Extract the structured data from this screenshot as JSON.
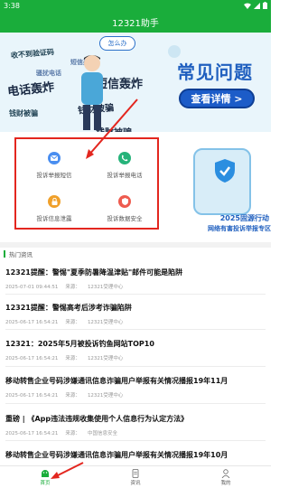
{
  "status_bar": {
    "time": "3:38"
  },
  "app_bar": {
    "title": "12321助手"
  },
  "banner": {
    "bubble": "怎么办",
    "keywords": [
      "收不到验证码",
      "电话轰炸",
      "骚扰电话",
      "钱财被骗",
      "短信轰炸",
      "短信轰炸",
      "钱财被骗",
      "钱财被骗"
    ],
    "headline": "常见问题",
    "detail_button": "查看详情 >"
  },
  "quick_actions": [
    {
      "label": "投诉举报短信",
      "icon": "mail-icon"
    },
    {
      "label": "投诉举报电话",
      "icon": "phone-icon"
    },
    {
      "label": "投诉信息泄露",
      "icon": "lock-icon"
    },
    {
      "label": "投诉数据安全",
      "icon": "shield-icon"
    }
  ],
  "promo": {
    "line1": "2025固源行动",
    "line2": "网络有害投诉举报专区"
  },
  "section": {
    "title": "热门资讯"
  },
  "news": [
    {
      "title": "12321提醒：警惕\"夏季防暑降温津贴\"邮件可能是陷阱",
      "date": "2025-07-01 09:44:51",
      "source_label": "来源：",
      "source": "12321受理中心"
    },
    {
      "title": "12321提醒：警惕高考后涉考诈骗陷阱",
      "date": "2025-06-17 16:54:21",
      "source_label": "来源：",
      "source": "12321受理中心"
    },
    {
      "title": "12321：2025年5月被投诉钓鱼网站TOP10",
      "date": "2025-06-17 16:54:21",
      "source_label": "来源：",
      "source": "12321受理中心"
    },
    {
      "title": "移动转售企业号码涉嫌通讯信息诈骗用户举报有关情况播报19年11月",
      "date": "2025-06-17 16:54:21",
      "source_label": "来源：",
      "source": "12321受理中心"
    },
    {
      "title": "重磅 | 《App违法违规收集使用个人信息行为认定方法》",
      "date": "2025-06-17 16:54:21",
      "source_label": "来源：",
      "source": "中国信息安全"
    },
    {
      "title": "移动转售企业号码涉嫌通讯信息诈骗用户举报有关情况播报19年10月",
      "date": "",
      "source_label": "",
      "source": ""
    }
  ],
  "tabs": [
    {
      "label": "首页",
      "active": true
    },
    {
      "label": "资讯",
      "active": false
    },
    {
      "label": "我的",
      "active": false
    }
  ],
  "colors": {
    "brand": "#1aad3b",
    "highlight": "#e3261f",
    "accent_blue": "#1f5fbf"
  }
}
